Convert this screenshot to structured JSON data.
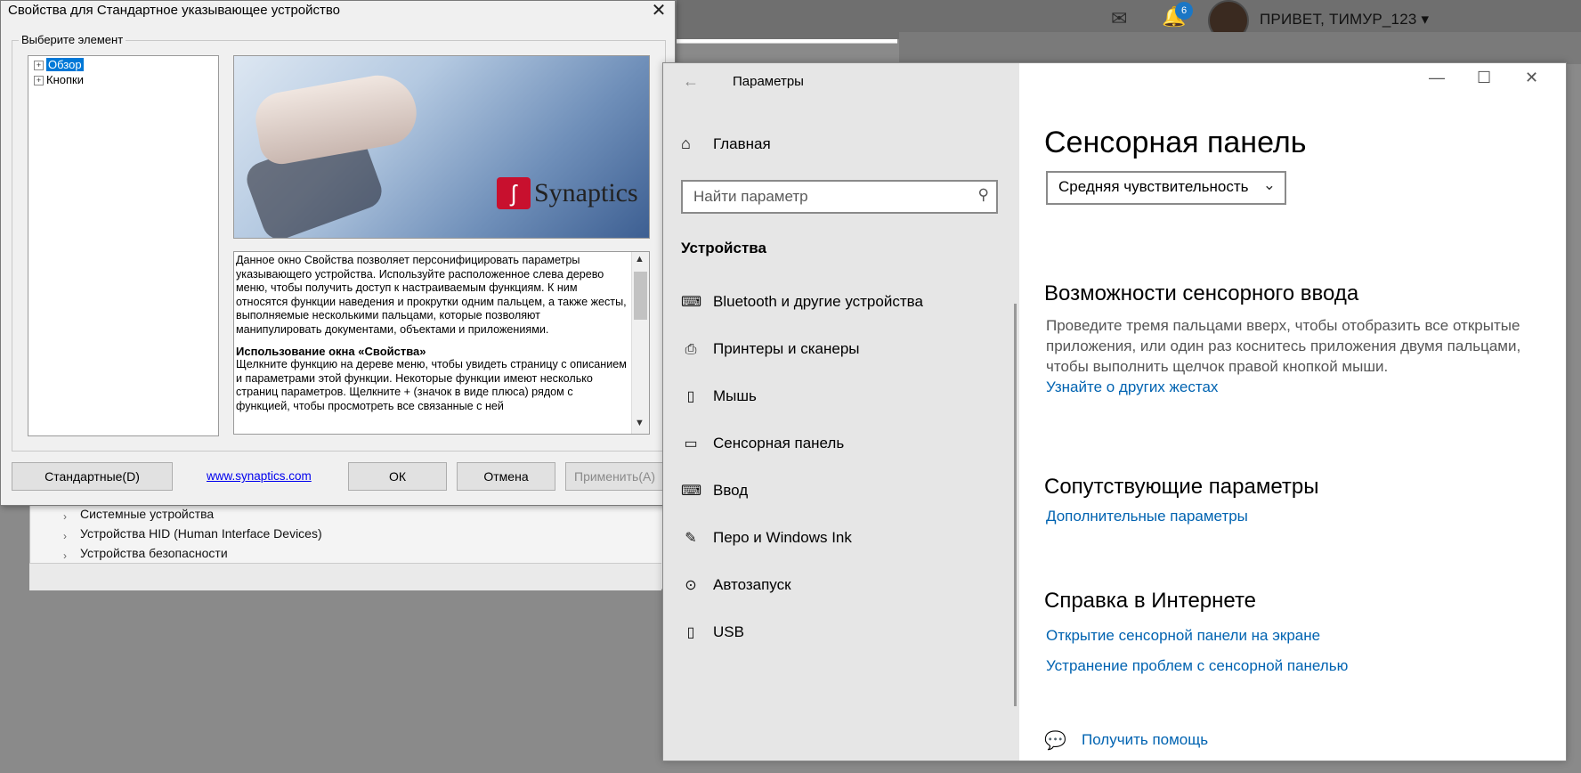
{
  "background": {
    "greeting": "ПРИВЕТ, ТИМУР_123 ▾",
    "notification_count": "6",
    "device_manager": {
      "rows": [
        "Системные устройства",
        "Устройства HID (Human Interface Devices)",
        "Устройства безопасности"
      ]
    }
  },
  "synaptics": {
    "title": "Свойства для Стандартное указывающее устройство",
    "group_label": "Выберите элемент",
    "tree": [
      {
        "label": "Обзор",
        "selected": true
      },
      {
        "label": "Кнопки",
        "selected": false
      }
    ],
    "logo_text": "Synaptics",
    "help_para1": "Данное окно Свойства позволяет персонифицировать параметры указывающего устройства. Используйте расположенное слева дерево меню, чтобы получить доступ к настраиваемым функциям. К ним относятся функции наведения и прокрутки одним пальцем, а также жесты, выполняемые несколькими пальцами, которые позволяют манипулировать документами, объектами и приложениями.",
    "help_heading": "Использование окна «Свойства»",
    "help_para2": "Щелкните функцию на дереве меню, чтобы увидеть страницу с описанием и параметрами этой функции. Некоторые функции имеют несколько страниц параметров. Щелкните + (значок в виде плюса) рядом с функцией, чтобы просмотреть все связанные с ней",
    "buttons": {
      "default": "Стандартные(D)",
      "link": "www.synaptics.com",
      "ok": "ОК",
      "cancel": "Отмена",
      "apply": "Применить(A)"
    }
  },
  "settings": {
    "window_title": "Параметры",
    "nav_home": "Главная",
    "search_placeholder": "Найти параметр",
    "section": "Устройства",
    "nav_items": [
      {
        "label": "Bluetooth и другие устройства",
        "icon": "bluetooth-devices-icon"
      },
      {
        "label": "Принтеры и сканеры",
        "icon": "printer-icon"
      },
      {
        "label": "Мышь",
        "icon": "mouse-icon"
      },
      {
        "label": "Сенсорная панель",
        "icon": "touchpad-icon"
      },
      {
        "label": "Ввод",
        "icon": "keyboard-icon"
      },
      {
        "label": "Перо и Windows Ink",
        "icon": "pen-icon"
      },
      {
        "label": "Автозапуск",
        "icon": "autoplay-icon"
      },
      {
        "label": "USB",
        "icon": "usb-icon"
      }
    ],
    "page_title": "Сенсорная панель",
    "sensitivity": "Средняя чувствительность",
    "touch_heading": "Возможности сенсорного ввода",
    "touch_text": "Проведите тремя пальцами вверх, чтобы отобразить все открытые приложения, или один раз коснитесь приложения двумя пальцами, чтобы выполнить щелчок правой кнопкой мыши.",
    "touch_link": "Узнайте о других жестах",
    "related_heading": "Сопутствующие параметры",
    "related_link": "Дополнительные параметры",
    "help_heading": "Справка в Интернете",
    "help_links": [
      "Открытие сенсорной панели на экране",
      "Устранение проблем с сенсорной панелью"
    ],
    "get_help": "Получить помощь"
  }
}
